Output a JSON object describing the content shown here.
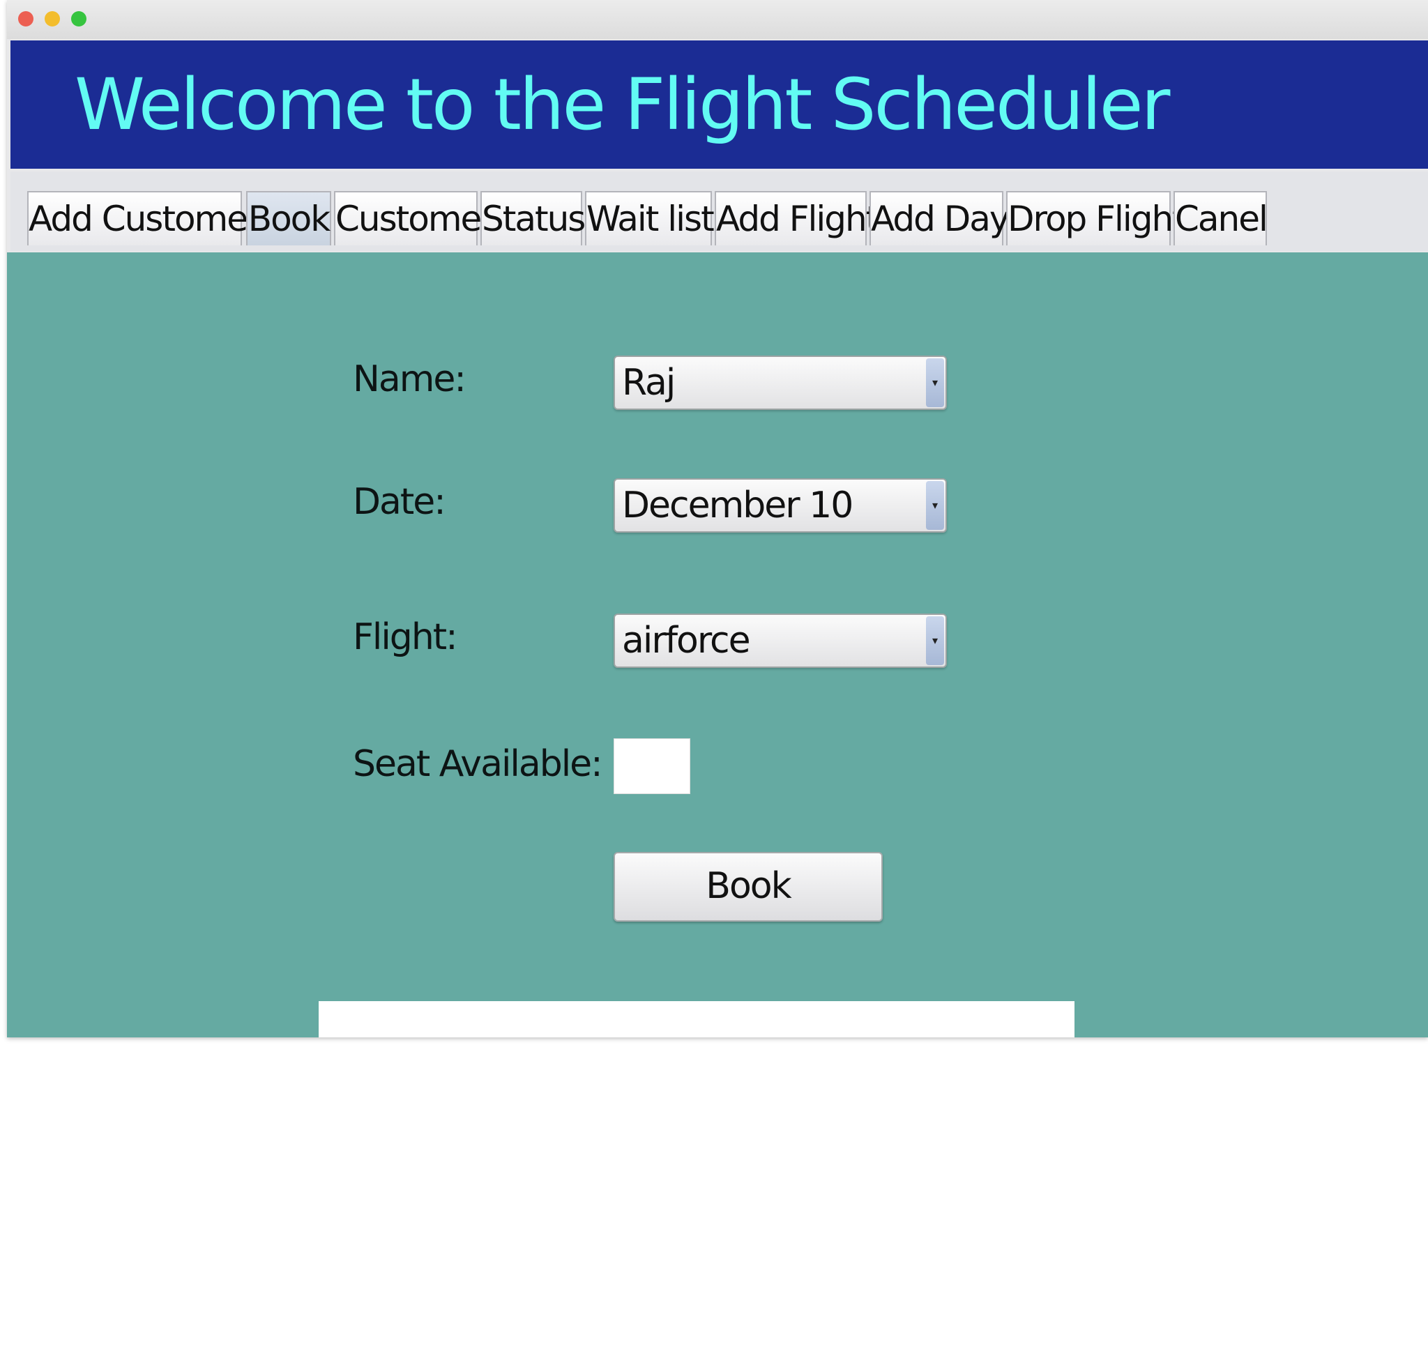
{
  "window": {
    "controls": [
      "close",
      "minimize",
      "zoom"
    ]
  },
  "header": {
    "title": "Welcome to the Flight Scheduler"
  },
  "tabs": [
    {
      "label": "Add Customer",
      "active": false
    },
    {
      "label": "Book",
      "active": true
    },
    {
      "label": "Customer",
      "active": false
    },
    {
      "label": "Status",
      "active": false
    },
    {
      "label": "Wait list",
      "active": false
    },
    {
      "label": "Add Flight",
      "active": false
    },
    {
      "label": "Add Day",
      "active": false
    },
    {
      "label": "Drop Flight",
      "active": false
    },
    {
      "label": "Canel",
      "active": false
    }
  ],
  "form": {
    "name_label": "Name:",
    "name_value": "Raj",
    "date_label": "Date:",
    "date_value": "December 10",
    "flight_label": "Flight:",
    "flight_value": "airforce",
    "seat_label": "Seat Available:",
    "seat_value": "",
    "book_button": "Book"
  },
  "colors": {
    "header_bg": "#1b2c94",
    "header_text": "#62fbf3",
    "content_bg": "#65aaa2"
  }
}
